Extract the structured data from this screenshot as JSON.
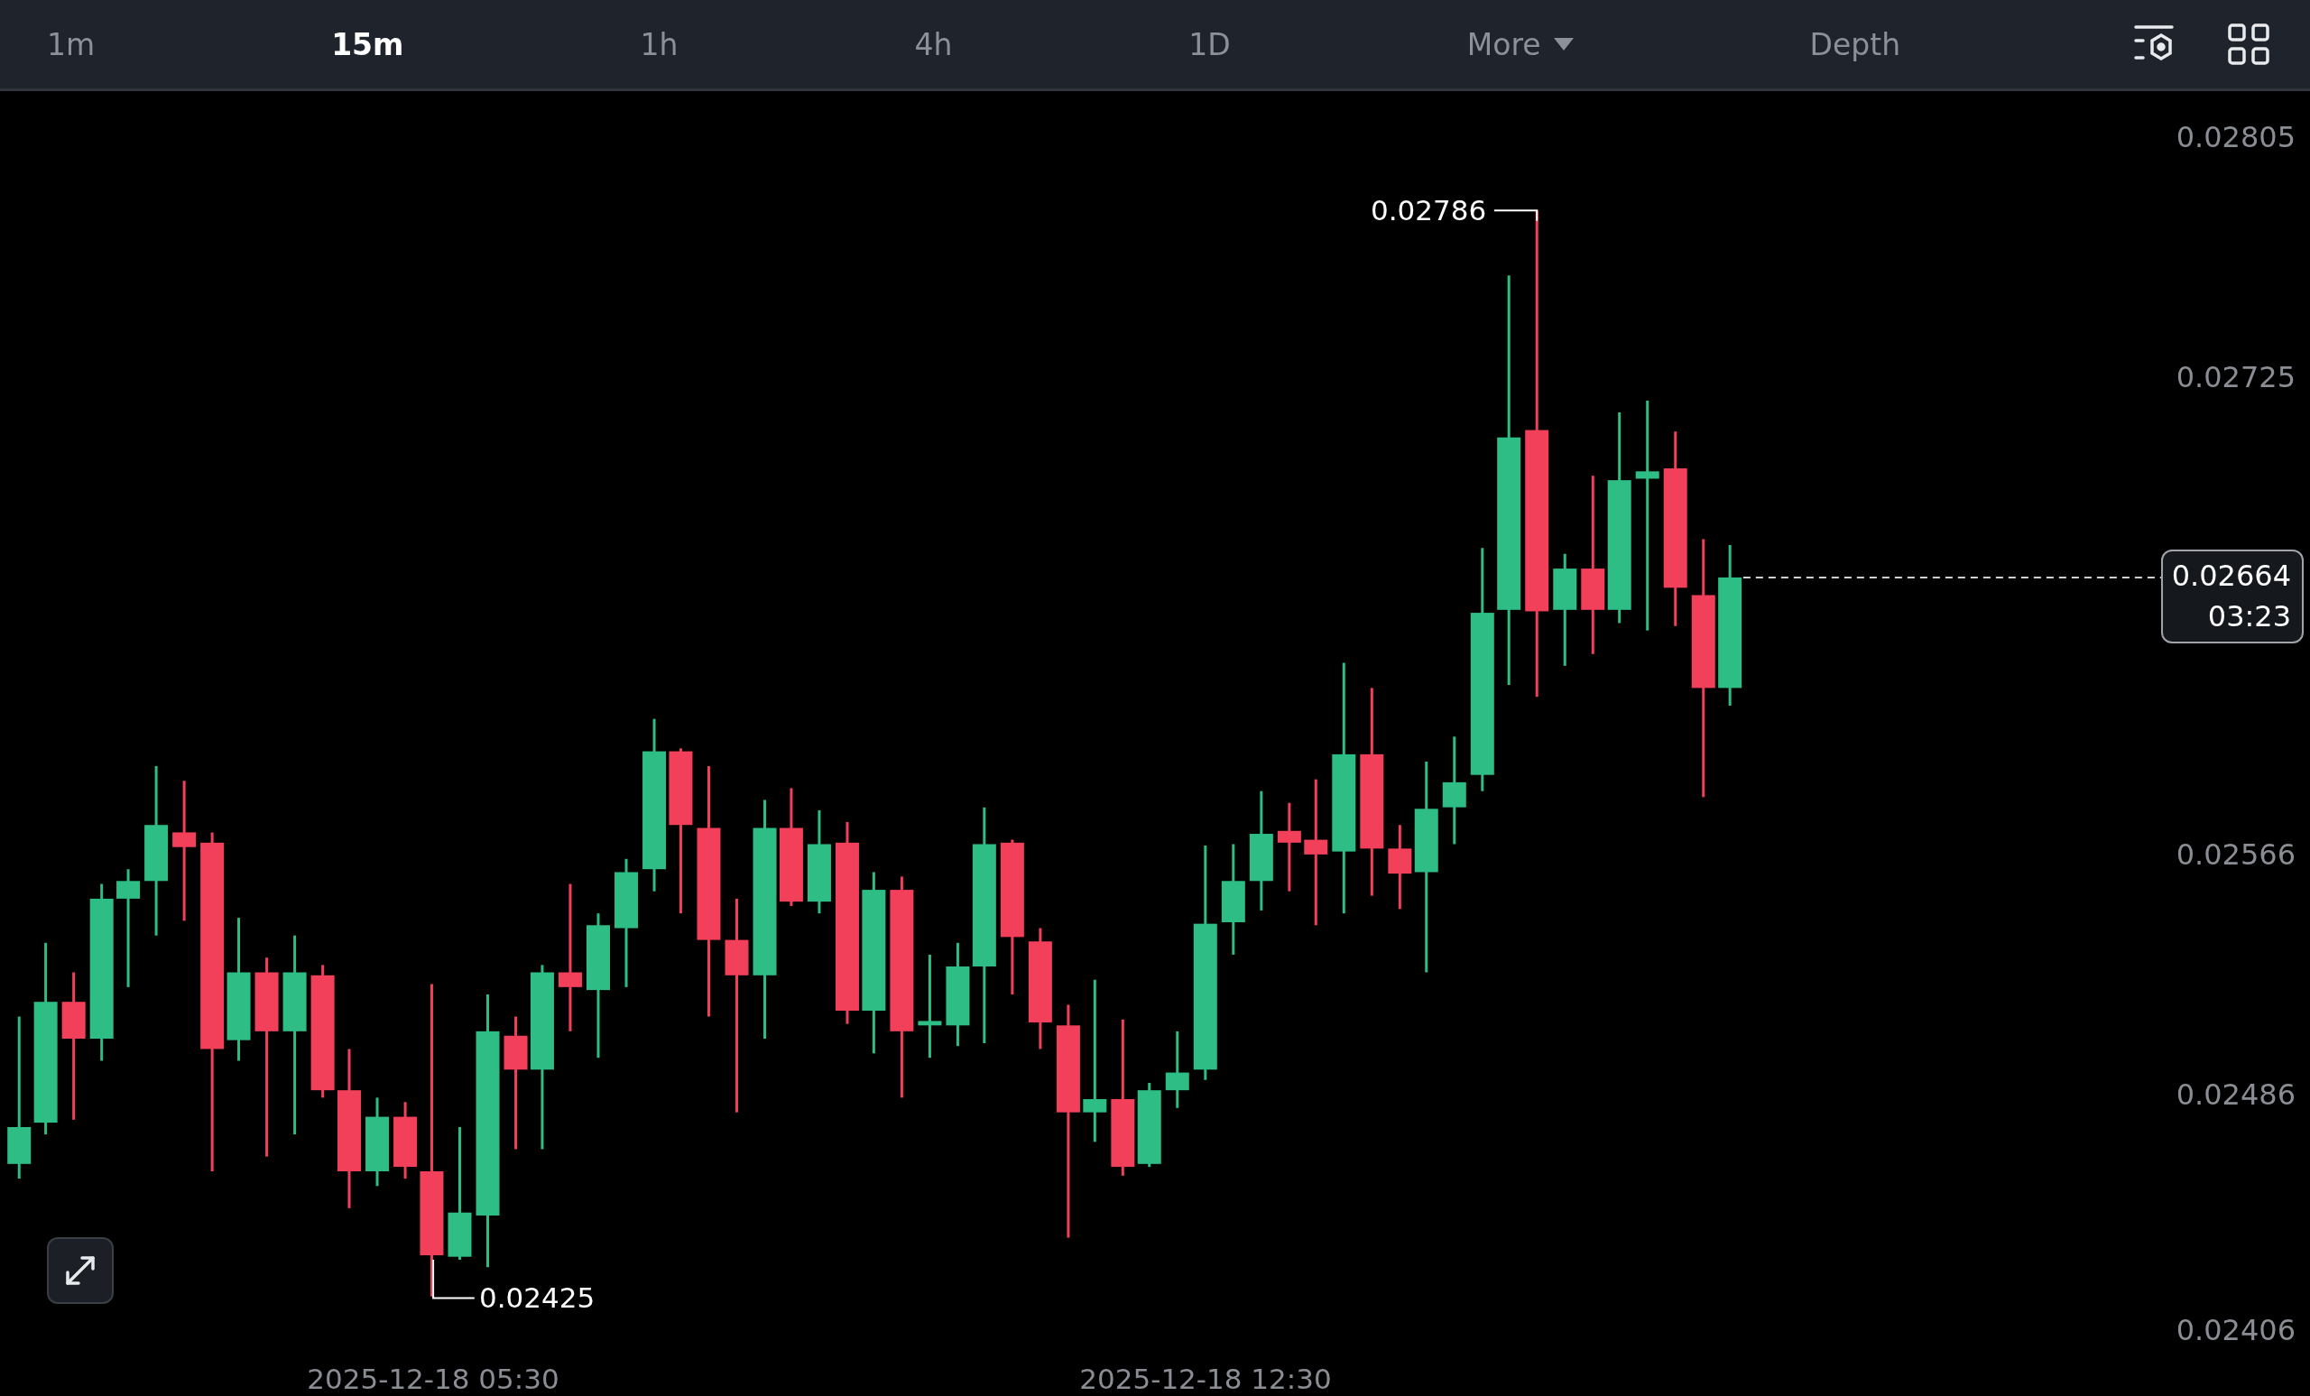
{
  "intervals": [
    {
      "label": "1m",
      "selected": false,
      "kind": "interval"
    },
    {
      "label": "15m",
      "selected": true,
      "kind": "interval"
    },
    {
      "label": "1h",
      "selected": false,
      "kind": "interval"
    },
    {
      "label": "4h",
      "selected": false,
      "kind": "interval"
    },
    {
      "label": "1D",
      "selected": false,
      "kind": "interval"
    },
    {
      "label": "More",
      "selected": false,
      "kind": "dropdown"
    },
    {
      "label": "Depth",
      "selected": false,
      "kind": "interval"
    }
  ],
  "price_axis": {
    "labels": [
      "0.02805",
      "0.02725",
      "0.02566",
      "0.02486",
      "0.02406"
    ]
  },
  "last_price": {
    "price": "0.02664",
    "countdown": "03:23"
  },
  "extremes": {
    "high": "0.02786",
    "low": "0.02425"
  },
  "time_axis": {
    "labels": [
      "2025-12-18 05:30",
      "2025-12-18 12:30"
    ]
  }
}
